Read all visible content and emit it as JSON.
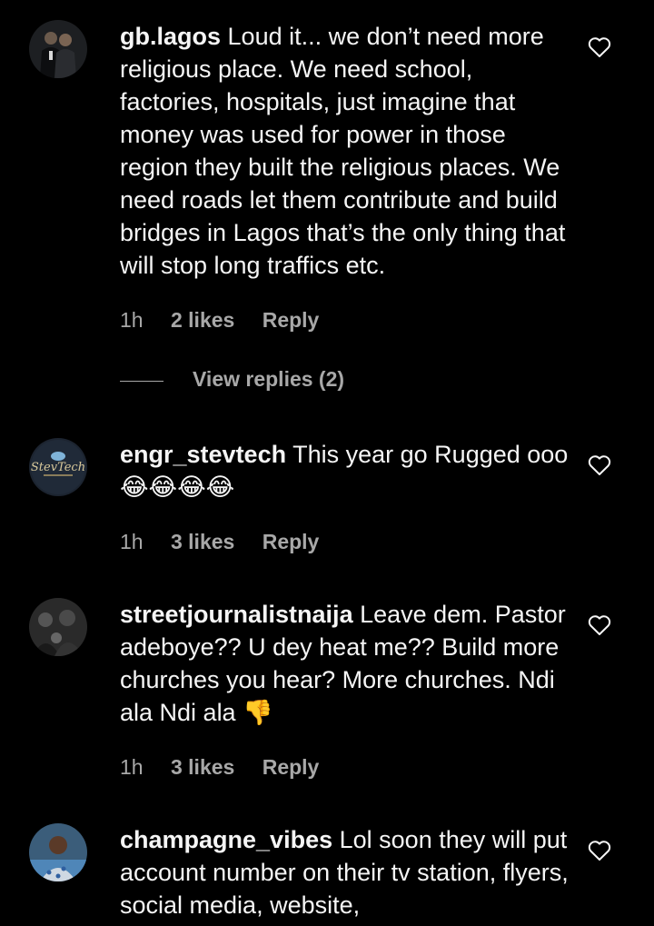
{
  "comments": [
    {
      "username": "gb.lagos",
      "text": "Loud it... we don’t need more religious place. We need school, factories, hospitals, just imagine that money was used for power in those region they built the religious places. We need roads let them contribute and build bridges in Lagos that’s the only thing that will stop long traffics etc.",
      "time": "1h",
      "likes": "2 likes",
      "reply": "Reply",
      "view_replies": "View replies (2)",
      "avatar_icon": "couple-photo-avatar"
    },
    {
      "username": "engr_stevtech",
      "text": "This year go Rugged ooo😂😂😂😂",
      "time": "1h",
      "likes": "3 likes",
      "reply": "Reply",
      "avatar_icon": "stevtech-logo-avatar",
      "avatar_logo_text": "StevTech"
    },
    {
      "username": "streetjournalistnaija",
      "text": "Leave dem. Pastor adeboye?? U dey heat me?? Build more churches you hear? More churches. Ndi ala Ndi ala 👎",
      "time": "1h",
      "likes": "3 likes",
      "reply": "Reply",
      "avatar_icon": "crowd-photo-avatar"
    },
    {
      "username": "champagne_vibes",
      "text": "Lol soon they will put account number on their tv station, flyers, social media, website,",
      "avatar_icon": "man-photo-avatar"
    }
  ],
  "icons": {
    "like": "heart-outline-icon"
  },
  "colors": {
    "background": "#000000",
    "text": "#f5f5f5",
    "secondary_text": "#a8a8a8"
  }
}
